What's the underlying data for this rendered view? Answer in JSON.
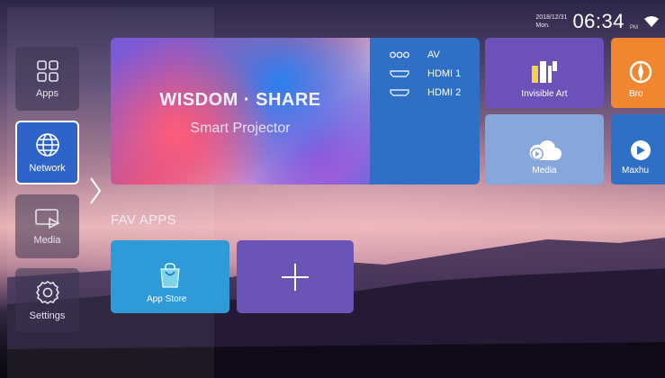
{
  "status": {
    "date": "2018/12/31",
    "weekday": "Mon.",
    "time": "06:34",
    "ampm": "PM"
  },
  "sidebar": {
    "items": [
      {
        "label": "Apps"
      },
      {
        "label": "Network"
      },
      {
        "label": "Media"
      },
      {
        "label": "Settings"
      }
    ],
    "active": "Network"
  },
  "hero": {
    "title": "WISDOM · SHARE",
    "subtitle": "Smart Projector",
    "sources": [
      {
        "icon": "av-icon",
        "label": "AV"
      },
      {
        "icon": "hdmi-icon",
        "label": "HDMI 1"
      },
      {
        "icon": "hdmi-icon",
        "label": "HDMI 2"
      }
    ]
  },
  "apps": [
    {
      "label": "Invisible Art",
      "color": "#6b51b8"
    },
    {
      "label": "Bro",
      "color": "#f0862f"
    },
    {
      "label": "Media",
      "color": "#87a7dc"
    },
    {
      "label": "Maxhu",
      "color": "#2f6fc6"
    }
  ],
  "fav": {
    "title": "FAV APPS",
    "items": [
      {
        "label": "App Store",
        "color": "#2f9ad8"
      }
    ],
    "add_color": "#6a54b6"
  }
}
